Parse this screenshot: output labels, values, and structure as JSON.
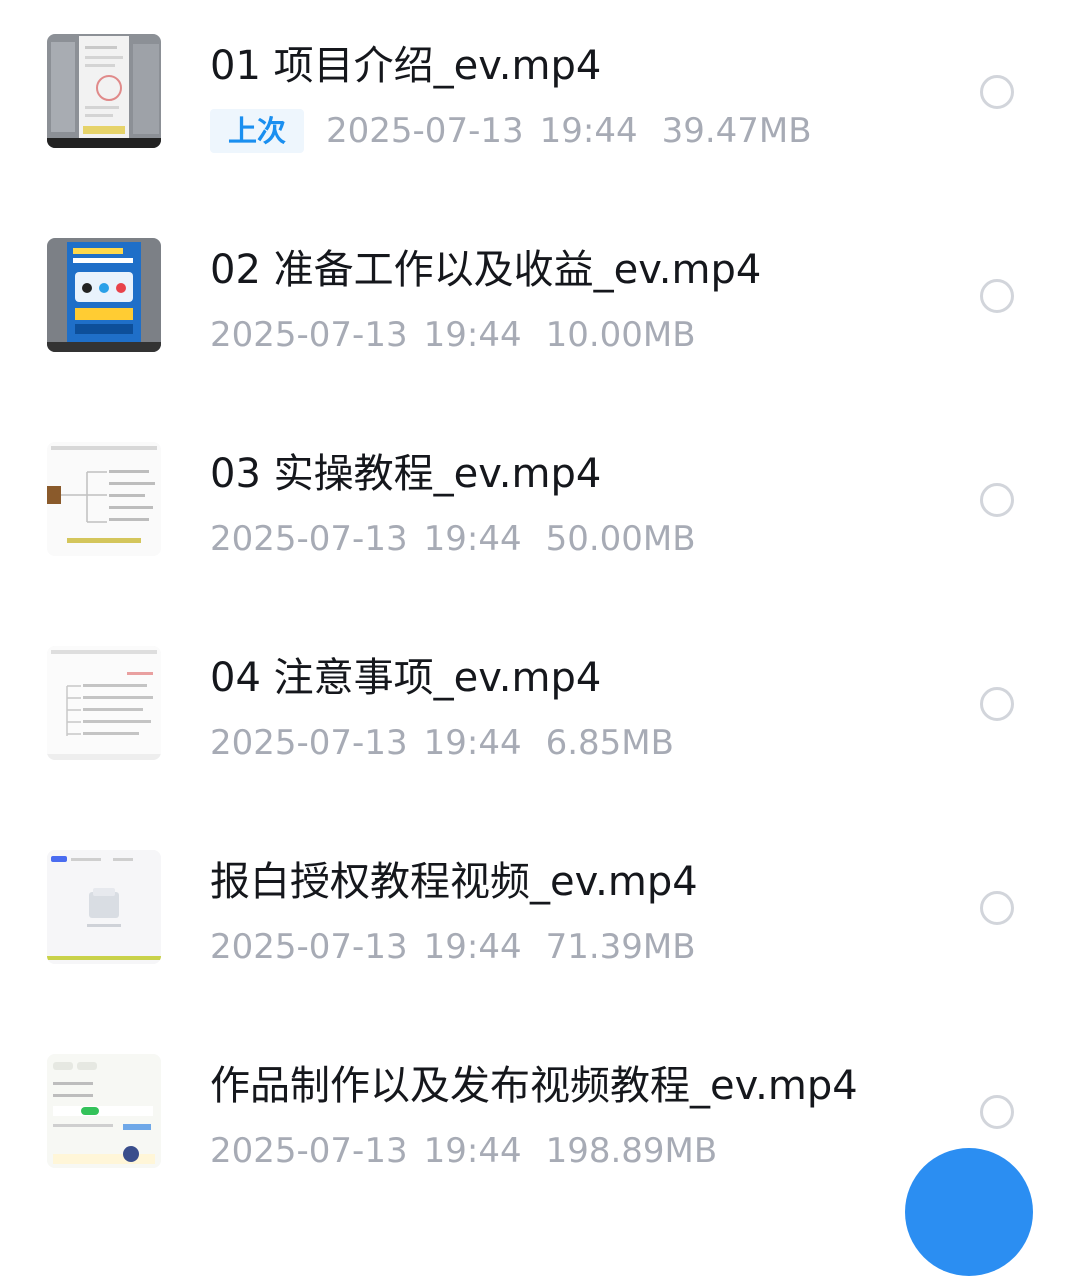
{
  "files": [
    {
      "name": "01 项目介绍_ev.mp4",
      "badge": "上次",
      "date": "2025-07-13",
      "time": "19:44",
      "size": "39.47MB",
      "thumbnail_icon": "video-thumbnail-icon"
    },
    {
      "name": "02 准备工作以及收益_ev.mp4",
      "date": "2025-07-13",
      "time": "19:44",
      "size": "10.00MB",
      "thumbnail_icon": "video-thumbnail-icon"
    },
    {
      "name": "03 实操教程_ev.mp4",
      "date": "2025-07-13",
      "time": "19:44",
      "size": "50.00MB",
      "thumbnail_icon": "video-thumbnail-icon"
    },
    {
      "name": "04 注意事项_ev.mp4",
      "date": "2025-07-13",
      "time": "19:44",
      "size": "6.85MB",
      "thumbnail_icon": "video-thumbnail-icon"
    },
    {
      "name": "报白授权教程视频_ev.mp4",
      "date": "2025-07-13",
      "time": "19:44",
      "size": "71.39MB",
      "thumbnail_icon": "video-thumbnail-icon"
    },
    {
      "name": "作品制作以及发布视频教程_ev.mp4",
      "date": "2025-07-13",
      "time": "19:44",
      "size": "198.89MB",
      "thumbnail_icon": "video-thumbnail-icon"
    }
  ],
  "colors": {
    "title_text": "#15171c",
    "meta_text": "#a7abb5",
    "badge_text": "#1a8ff0",
    "badge_bg": "#eef6fd",
    "radio_border": "#d2d5db",
    "fab": "#2b8ef2"
  }
}
